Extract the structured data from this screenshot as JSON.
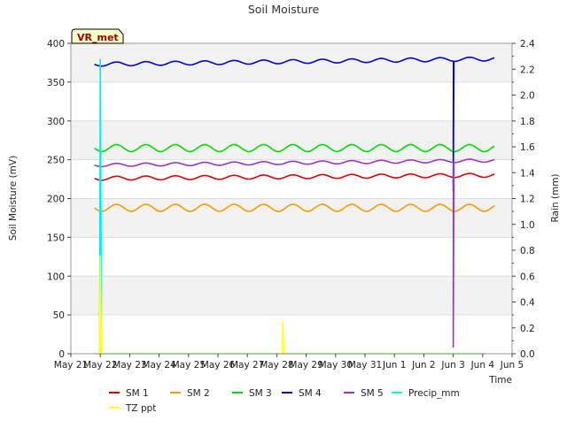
{
  "chart_data": {
    "type": "line",
    "title": "Soil Moisture",
    "site_label": "VR_met",
    "xlabel": "Time",
    "ylabel_left": "Soil Moisture (mV)",
    "ylabel_right": "Rain (mm)",
    "ylim_left": [
      0,
      400
    ],
    "ylim_right": [
      0.0,
      2.4
    ],
    "yticks_left": [
      "0",
      "50",
      "100",
      "150",
      "200",
      "250",
      "300",
      "350",
      "400"
    ],
    "yticks_right": [
      "0.0",
      "0.2",
      "0.4",
      "0.6",
      "0.8",
      "1.0",
      "1.2",
      "1.4",
      "1.6",
      "1.8",
      "2.0",
      "2.2",
      "2.4"
    ],
    "x_ticks": [
      "May 21",
      "May 22",
      "May 23",
      "May 24",
      "May 25",
      "May 26",
      "May 27",
      "May 28",
      "May 29",
      "May 30",
      "May 31",
      "Jun 1",
      "Jun 2",
      "Jun 3",
      "Jun 4",
      "Jun 5"
    ],
    "xlim_days": [
      0,
      15
    ],
    "grid": true,
    "legend_position": "bottom",
    "series": [
      {
        "name": "SM 1",
        "color": "#dd0000",
        "axis": "left",
        "base": 226,
        "trend": 4,
        "amp": 2.5,
        "dip_at": 13.0,
        "dip_to": 221
      },
      {
        "name": "SM 2",
        "color": "#ff9900",
        "axis": "left",
        "base": 188,
        "trend": 0,
        "amp": 4.5,
        "dip_at": 13.0,
        "dip_to": 180
      },
      {
        "name": "SM 3",
        "color": "#00dd00",
        "axis": "left",
        "base": 265,
        "trend": 0,
        "amp": 4.5,
        "dip_at": 13.0,
        "dip_to": 258
      },
      {
        "name": "SM 4",
        "color": "#0000cc",
        "axis": "left",
        "base": 373,
        "trend": 7,
        "amp": 2.5,
        "dip_at": 13.0,
        "dip_to": 210
      },
      {
        "name": "SM 5",
        "color": "#9933cc",
        "axis": "left",
        "base": 243,
        "trend": 6,
        "amp": 2.0,
        "dip_at": 13.0,
        "dip_to": 8
      },
      {
        "name": "Precip_mm",
        "color": "#00eeee",
        "axis": "right",
        "start": 0.8,
        "end": 15.0,
        "spikes": [
          {
            "x": 1.0,
            "y": 2.28,
            "bottom": 0.0
          }
        ]
      },
      {
        "name": "TZ ppt",
        "color": "#ffff33",
        "axis": "right",
        "start": 0.8,
        "end": 15.0,
        "spikes": [
          {
            "x": 1.0,
            "y": 0.76,
            "bottom": 0.0
          },
          {
            "x": 7.2,
            "y": 0.25,
            "bottom": 0.0
          }
        ]
      }
    ]
  }
}
